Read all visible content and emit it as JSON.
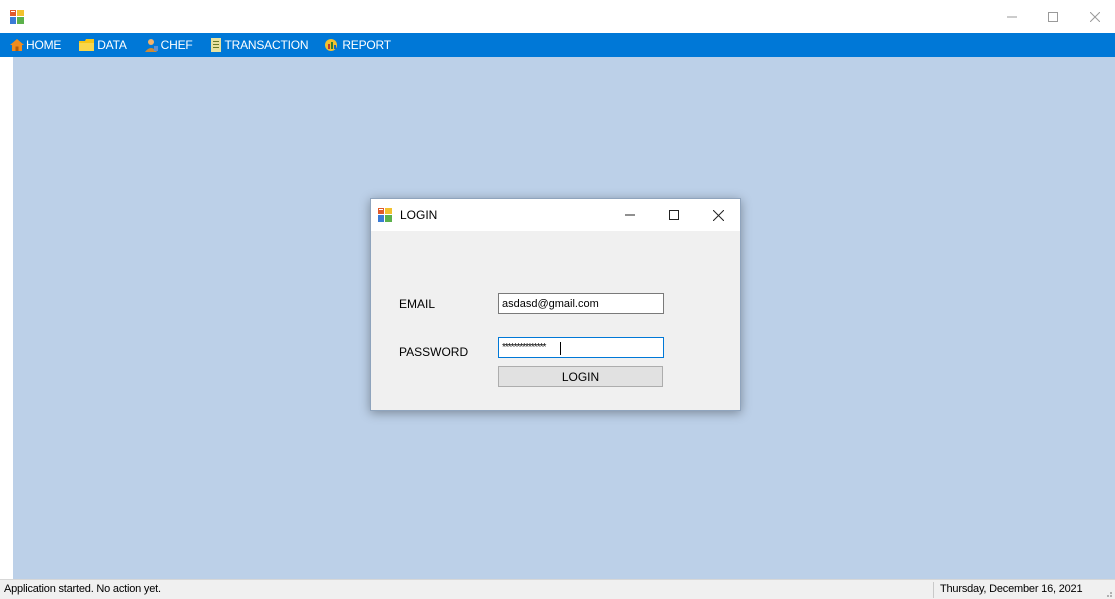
{
  "window": {
    "icon": "app-form-icon",
    "controls": {
      "minimize": "—",
      "maximize": "☐",
      "close": "✕"
    }
  },
  "menu": {
    "items": [
      {
        "label": "HOME",
        "icon": "house-icon"
      },
      {
        "label": "DATA",
        "icon": "folder-icon"
      },
      {
        "label": "CHEF",
        "icon": "user-icon"
      },
      {
        "label": "TRANSACTION",
        "icon": "document-icon"
      },
      {
        "label": "REPORT",
        "icon": "report-icon"
      }
    ],
    "background": "#0078d7"
  },
  "mdi": {
    "background": "#bcd0e8"
  },
  "login_dialog": {
    "title": "LOGIN",
    "controls": {
      "minimize": "—",
      "maximize": "☐",
      "close": "✕"
    },
    "email_label": "EMAIL",
    "email_value": "asdasd@gmail.com",
    "password_label": "PASSWORD",
    "password_value": "***************",
    "login_button": "LOGIN"
  },
  "status": {
    "message": "Application started. No action yet.",
    "date": "Thursday, December 16, 2021"
  }
}
